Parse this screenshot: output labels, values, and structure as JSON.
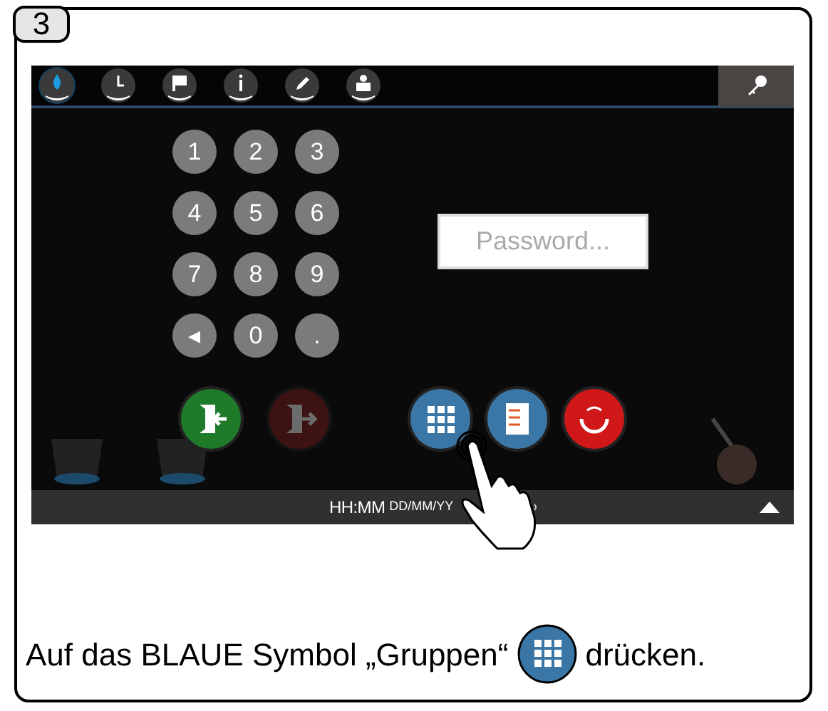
{
  "step_badge": "3",
  "screen": {
    "tabs": [
      {
        "kind": "drop",
        "selected": true
      },
      {
        "kind": "clock",
        "selected": false
      },
      {
        "kind": "flag",
        "selected": false
      },
      {
        "kind": "info",
        "selected": false
      },
      {
        "kind": "pencil",
        "selected": false
      },
      {
        "kind": "person",
        "selected": false
      }
    ],
    "keypad": [
      "1",
      "2",
      "3",
      "4",
      "5",
      "6",
      "7",
      "8",
      "9",
      "◂",
      "0",
      "."
    ],
    "password": {
      "placeholder": "Password..."
    },
    "actions": [
      {
        "kind": "enter",
        "disabled": false
      },
      {
        "kind": "exit",
        "disabled": true
      },
      {
        "kind": "groups",
        "disabled": false
      },
      {
        "kind": "checklist",
        "disabled": false
      },
      {
        "kind": "refresh",
        "disabled": false
      }
    ],
    "status_bar": {
      "time": "HH:MM",
      "date": "DD/MM/YY"
    }
  },
  "caption": {
    "before": "Auf das BLAUE Symbol „Gruppen“",
    "after": "drücken."
  }
}
